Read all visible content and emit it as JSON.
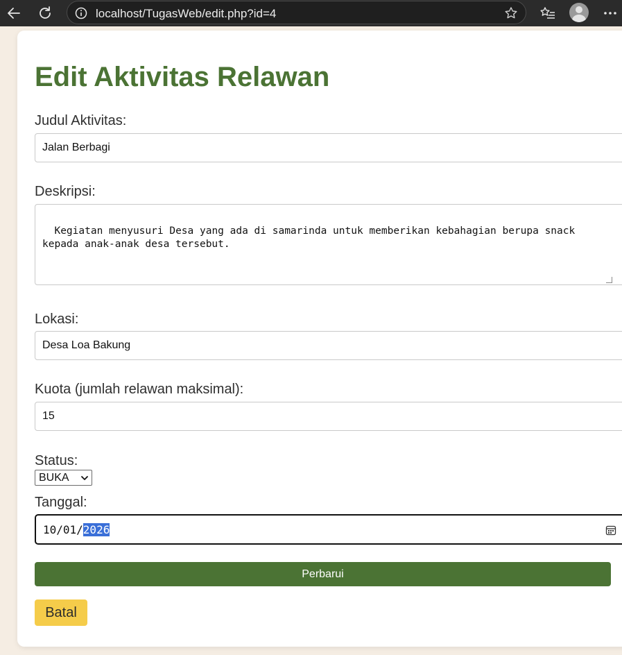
{
  "browser": {
    "url": "localhost/TugasWeb/edit.php?id=4",
    "icons": [
      "back-arrow-icon",
      "refresh-icon",
      "info-icon",
      "star-icon",
      "favorites-icon",
      "profile-avatar",
      "more-icon"
    ]
  },
  "page": {
    "title": "Edit Aktivitas Relawan"
  },
  "form": {
    "judul_label": "Judul Aktivitas:",
    "judul_value": "Jalan Berbagi",
    "deskripsi_label": "Deskripsi:",
    "deskripsi_value": "Kegiatan menyusuri Desa yang ada di samarinda untuk memberikan kebahagian berupa snack\nkepada anak-anak desa tersebut.",
    "lokasi_label": "Lokasi:",
    "lokasi_value": "Desa Loa Bakung",
    "kuota_label": "Kuota (jumlah relawan maksimal):",
    "kuota_value": "15",
    "status_label": "Status:",
    "status_value": "BUKA",
    "tanggal_label": "Tanggal:",
    "tanggal_day_month": "10/01/",
    "tanggal_year": "2026",
    "submit_label": "Perbarui",
    "cancel_label": "Batal"
  },
  "colors": {
    "accent": "#4b7334",
    "cancel": "#f5cc4a",
    "page_background": "#f5ede3",
    "selection": "#3a6fd8"
  }
}
